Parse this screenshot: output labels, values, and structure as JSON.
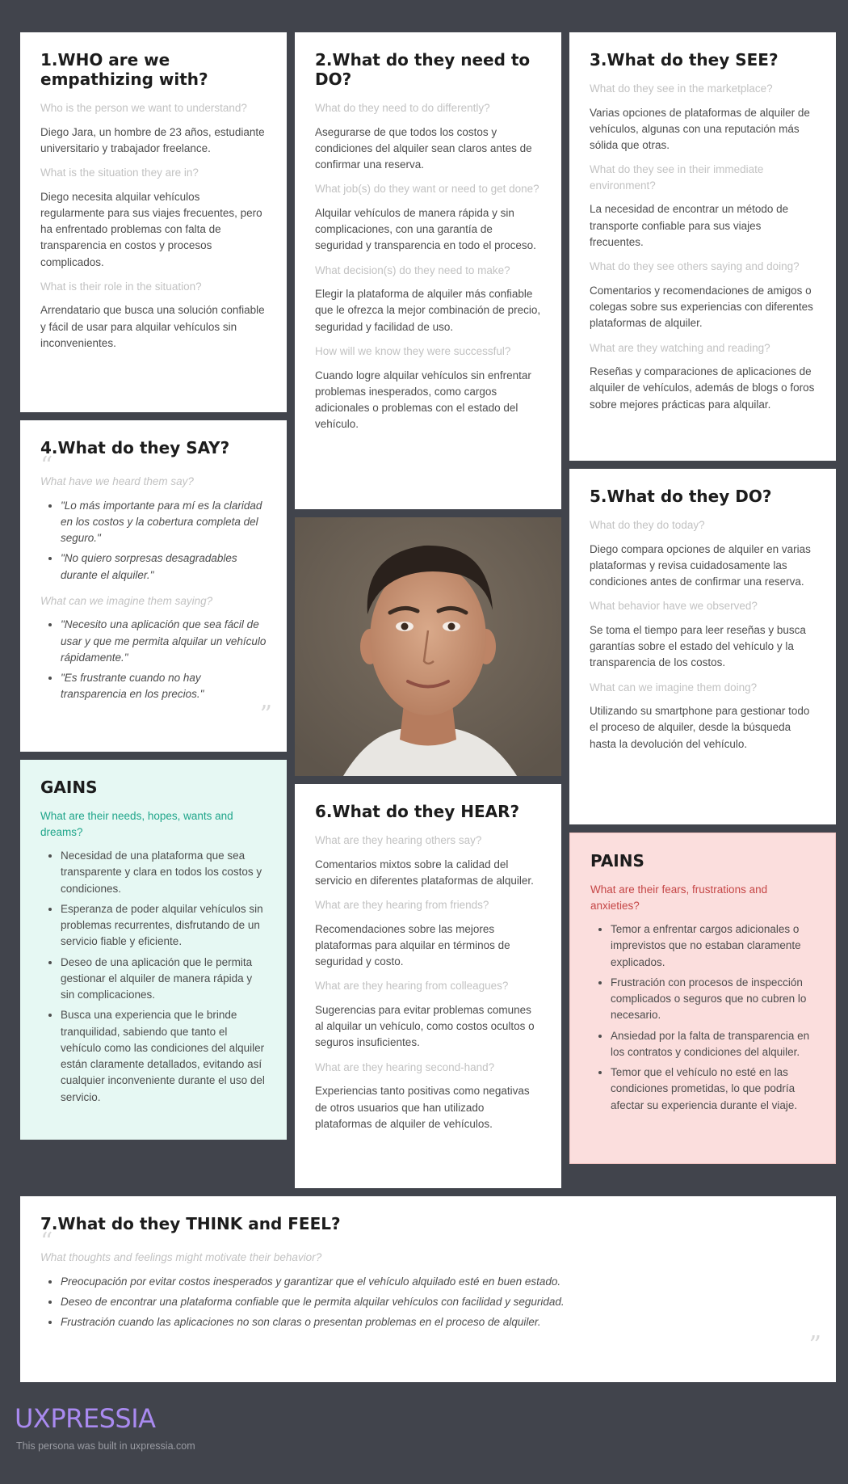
{
  "who": {
    "title": "1.WHO are we empathizing with?",
    "q1": "Who is the person we want to understand?",
    "a1": "Diego Jara, un hombre de 23 años, estudiante universitario y trabajador freelance.",
    "q2": "What is the situation they are in?",
    "a2": "Diego necesita alquilar vehículos regularmente para sus viajes frecuentes, pero ha enfrentado problemas con falta de transparencia en costos y procesos complicados.",
    "q3": "What is their role in the situation?",
    "a3": "Arrendatario que busca una solución confiable y fácil de usar para alquilar vehículos sin inconvenientes."
  },
  "do_need": {
    "title": "2.What do they need to DO?",
    "q1": "What do they need to do differently?",
    "a1": "Asegurarse de que todos los costos y condiciones del alquiler sean claros antes de confirmar una reserva.",
    "q2": "What job(s) do they want or need to get done?",
    "a2": "Alquilar vehículos de manera rápida y sin complicaciones, con una garantía de seguridad y transparencia en todo el proceso.",
    "q3": "What decision(s) do they need to make?",
    "a3": "Elegir la plataforma de alquiler más confiable que le ofrezca la mejor combinación de precio, seguridad y facilidad de uso.",
    "q4": "How will we know they were successful?",
    "a4": "Cuando logre alquilar vehículos sin enfrentar problemas inesperados, como cargos adicionales o problemas con el estado del vehículo."
  },
  "see": {
    "title": "3.What do they SEE?",
    "q1": "What do they see in the marketplace?",
    "a1": "Varias opciones de plataformas de alquiler de vehículos, algunas con una reputación más sólida que otras.",
    "q2": "What do they see in their immediate environment?",
    "a2": "La necesidad de encontrar un método de transporte confiable para sus viajes frecuentes.",
    "q3": "What do they see others saying and doing?",
    "a3": "Comentarios y recomendaciones de amigos o colegas sobre sus experiencias con diferentes plataformas de alquiler.",
    "q4": "What are they watching and reading?",
    "a4": "Reseñas y comparaciones de aplicaciones de alquiler de vehículos, además de blogs o foros sobre mejores prácticas para alquilar."
  },
  "say": {
    "title": "4.What do they SAY?",
    "q1": "What have we heard them say?",
    "heard": [
      "\"Lo más importante para mí es la claridad en los costos y la cobertura completa del seguro.\"",
      "\"No quiero sorpresas desagradables durante el alquiler.\""
    ],
    "q2": "What can we imagine them saying?",
    "imagine": [
      "\"Necesito una aplicación que sea fácil de usar y que me permita alquilar un vehículo rápidamente.\"",
      "\"Es frustrante cuando no hay transparencia en los precios.\""
    ]
  },
  "do_today": {
    "title": "5.What do they DO?",
    "q1": "What do they do today?",
    "a1": "Diego compara opciones de alquiler en varias plataformas y revisa cuidadosamente las condiciones antes de confirmar una reserva.",
    "q2": "What behavior have we observed?",
    "a2": "Se toma el tiempo para leer reseñas y busca garantías sobre el estado del vehículo y la transparencia de los costos.",
    "q3": "What can we imagine them doing?",
    "a3": "Utilizando su smartphone para gestionar todo el proceso de alquiler, desde la búsqueda hasta la devolución del vehículo."
  },
  "gains": {
    "title": "GAINS",
    "q": "What are their needs, hopes, wants and dreams?",
    "items": [
      "Necesidad de una plataforma que sea transparente y clara en todos los costos y condiciones.",
      "Esperanza de poder alquilar vehículos sin problemas recurrentes, disfrutando de un servicio fiable y eficiente.",
      "Deseo de una aplicación que le permita gestionar el alquiler de manera rápida y sin complicaciones.",
      "Busca una experiencia que le brinde tranquilidad, sabiendo que tanto el vehículo como las condiciones del alquiler están claramente detallados, evitando así cualquier inconveniente durante el uso del servicio."
    ]
  },
  "hear": {
    "title": "6.What do they HEAR?",
    "q1": "What are they hearing others say?",
    "a1": "Comentarios mixtos sobre la calidad del servicio en diferentes plataformas de alquiler.",
    "q2": "What are they hearing from friends?",
    "a2": "Recomendaciones sobre las mejores plataformas para alquilar en términos de seguridad y costo.",
    "q3": "What are they hearing  from colleagues?",
    "a3": "Sugerencias para evitar problemas comunes al alquilar un vehículo, como costos ocultos o seguros insuficientes.",
    "q4": "What are they hearing second-hand?",
    "a4": "Experiencias tanto positivas como negativas de otros usuarios que han utilizado plataformas de alquiler de vehículos."
  },
  "pains": {
    "title": "PAINS",
    "q": "What are their fears, frustrations and anxieties?",
    "items": [
      "Temor a enfrentar cargos adicionales o imprevistos que no estaban claramente explicados.",
      "Frustración con procesos de inspección complicados o seguros que no cubren lo necesario.",
      "Ansiedad por la falta de transparencia en los contratos y condiciones del alquiler.",
      "Temor que el vehículo no esté en las condiciones prometidas, lo que podría afectar su experiencia durante el viaje."
    ]
  },
  "think": {
    "title": "7.What do they THINK and FEEL?",
    "q": "What thoughts and feelings might motivate their behavior?",
    "items": [
      "Preocupación por evitar costos inesperados y garantizar que el vehículo alquilado esté en buen estado.",
      "Deseo de encontrar una plataforma confiable que le permita alquilar vehículos con facilidad y seguridad.",
      "Frustración cuando las aplicaciones no son claras o presentan problemas en el proceso de alquiler."
    ]
  },
  "footer": {
    "brand": "UXPRESSIA",
    "note": "This persona was built in uxpressia.com"
  },
  "colors": {
    "background": "#41444c",
    "gains_bg": "#e6f8f3",
    "gains_accent": "#1fa58a",
    "pains_bg": "#fbdedd",
    "pains_accent": "#c54646",
    "brand": "#a98af0"
  },
  "icons": {
    "quote_open": "“",
    "quote_close": "”"
  }
}
